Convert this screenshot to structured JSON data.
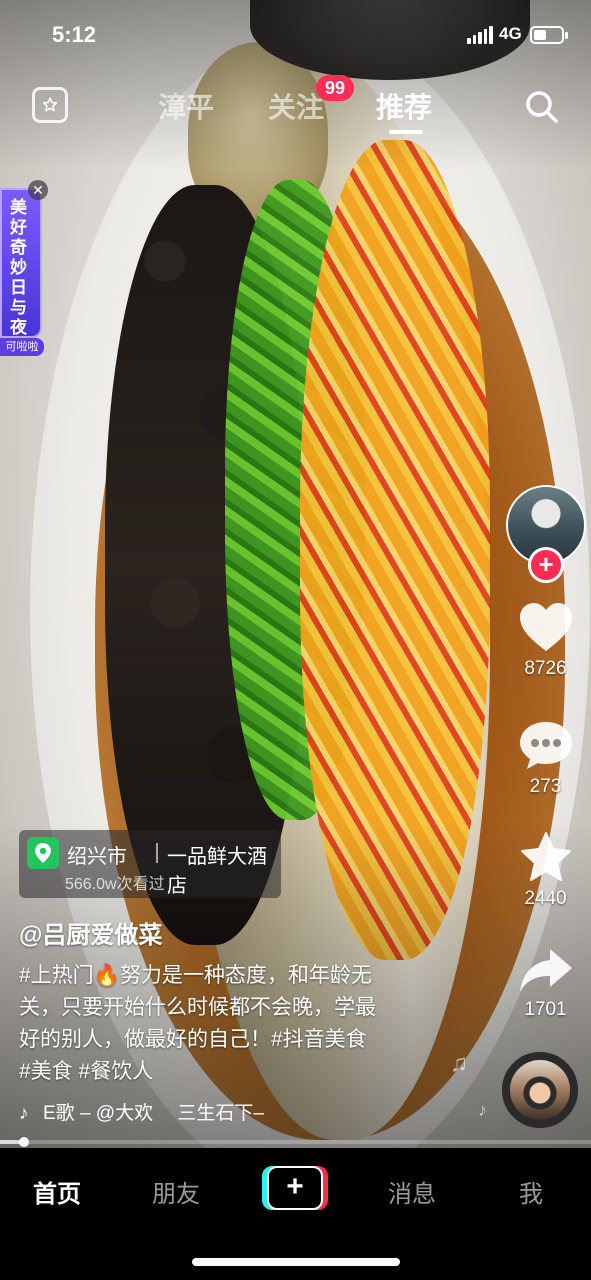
{
  "status_bar": {
    "time": "5:12",
    "network": "4G",
    "battery_level": 0.45
  },
  "top_nav": {
    "tabs": [
      {
        "label": "漳平",
        "active": false
      },
      {
        "label": "关注",
        "active": false
      },
      {
        "label": "推荐",
        "active": true
      }
    ],
    "follow_badge": "99"
  },
  "banner": {
    "text": "美好奇妙日与夜",
    "tag": "可啦啦",
    "close": "✕"
  },
  "video": {
    "location": {
      "city": "绍兴市",
      "place": "一品鲜大酒店",
      "views": "566.0w次看过"
    },
    "author": "@吕厨爱做菜",
    "caption_lines": [
      "#上热门🔥努力是一种态度，和年龄无",
      "关，只要开始什么时候都不会晚，学最",
      "好的别人，做最好的自己！#抖音美食",
      "#美食 #餐饮人"
    ],
    "music": "E歌 – @大欢　 三生石下–",
    "progress": 0.04
  },
  "rail": {
    "follow_plus": "+",
    "likes": "8726",
    "comments": "273",
    "favorites": "2440",
    "shares": "1701"
  },
  "tabbar": {
    "items": [
      {
        "label": "首页",
        "active": true
      },
      {
        "label": "朋友",
        "active": false
      },
      {
        "label": "+",
        "active": false
      },
      {
        "label": "消息",
        "active": false
      },
      {
        "label": "我",
        "active": false
      }
    ]
  },
  "colors": {
    "accent_red": "#fe2c55",
    "accent_cyan": "#25f4ee",
    "location_green": "#22c55e"
  }
}
